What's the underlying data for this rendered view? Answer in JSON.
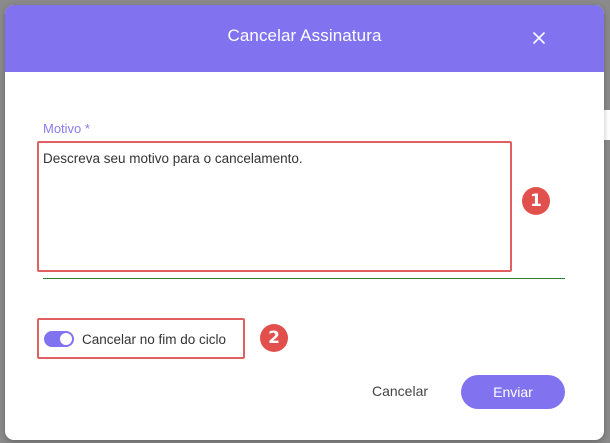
{
  "colors": {
    "accent": "#8172ef",
    "annotation": "#e0605f",
    "input_underline": "#2e7d32"
  },
  "dialog": {
    "title": "Cancelar Assinatura",
    "close_icon": "close-icon"
  },
  "form": {
    "reason_label": "Motivo *",
    "reason_placeholder": "Descreva seu motivo para o cancelamento.",
    "reason_value": "",
    "cancel_at_period_end_label": "Cancelar no fim do ciclo",
    "cancel_at_period_end_checked": true
  },
  "annotations": [
    {
      "number": "1"
    },
    {
      "number": "2"
    }
  ],
  "actions": {
    "cancel_label": "Cancelar",
    "submit_label": "Enviar"
  }
}
